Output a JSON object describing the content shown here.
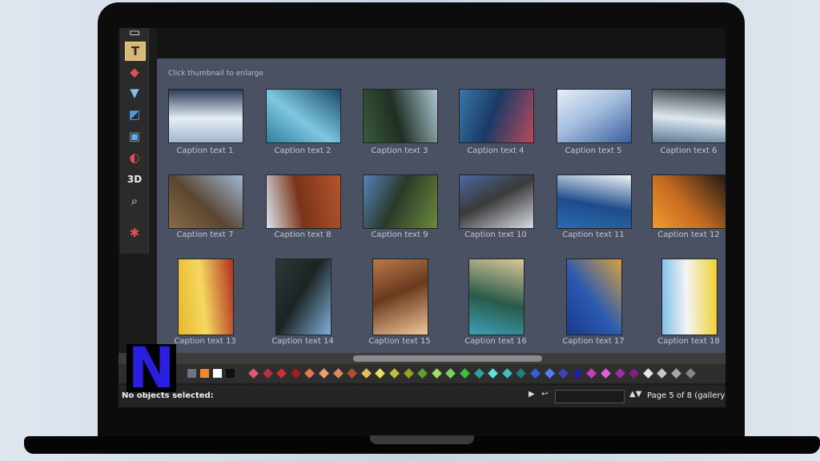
{
  "gallery": {
    "hint": "Click thumbnail to enlarge",
    "items": [
      {
        "caption": "Caption text 1",
        "colors": [
          "#9fb6cf",
          "#2b3d55",
          "#e6eef6"
        ]
      },
      {
        "caption": "Caption text 2",
        "colors": [
          "#2f7fa0",
          "#1a4a66",
          "#7ec7df"
        ]
      },
      {
        "caption": "Caption text 3",
        "colors": [
          "#3a5a3a",
          "#aac4d0",
          "#1f2f24"
        ]
      },
      {
        "caption": "Caption text 4",
        "colors": [
          "#3778a8",
          "#b84a5a",
          "#1a3a66"
        ]
      },
      {
        "caption": "Caption text 5",
        "colors": [
          "#e8eef5",
          "#3b5f9e",
          "#a6bfe0"
        ]
      },
      {
        "caption": "Caption text 6",
        "colors": [
          "#5a7898",
          "#2e3a3e",
          "#dfe8ef"
        ]
      },
      {
        "caption": "Caption text 7",
        "colors": [
          "#8a6a48",
          "#9fb8d6",
          "#5a4632"
        ]
      },
      {
        "caption": "Caption text 8",
        "colors": [
          "#d9e4ee",
          "#b4552e",
          "#7a3418"
        ]
      },
      {
        "caption": "Caption text 9",
        "colors": [
          "#5682b8",
          "#6a8a3a",
          "#2a3a2a"
        ]
      },
      {
        "caption": "Caption text 10",
        "colors": [
          "#4a6aa0",
          "#d8dde4",
          "#3a3a3a"
        ]
      },
      {
        "caption": "Caption text 11",
        "colors": [
          "#2a6ab0",
          "#f0f4f8",
          "#1e4c8a"
        ]
      },
      {
        "caption": "Caption text 12",
        "colors": [
          "#f29a2e",
          "#1d1a18",
          "#c46a20"
        ]
      },
      {
        "caption": "Caption text 13",
        "colors": [
          "#e8b830",
          "#b03020",
          "#f5d860"
        ]
      },
      {
        "caption": "Caption text 14",
        "colors": [
          "#2a3a3a",
          "#7fb0d8",
          "#1c2424"
        ]
      },
      {
        "caption": "Caption text 15",
        "colors": [
          "#b87a4a",
          "#f0c89a",
          "#6a3a1e"
        ]
      },
      {
        "caption": "Caption text 16",
        "colors": [
          "#3aa0b8",
          "#d8c89a",
          "#2a5a4a"
        ]
      },
      {
        "caption": "Caption text 17",
        "colors": [
          "#1a3a8a",
          "#d8a040",
          "#2a5ab0"
        ]
      },
      {
        "caption": "Caption text 18",
        "colors": [
          "#7fc0e8",
          "#f0d030",
          "#f4f4f4"
        ]
      }
    ]
  },
  "palette": {
    "swatches": [
      "#6e7582",
      "#f08a2e",
      "#ffffff",
      "#101010"
    ],
    "diamonds": [
      "#e05a6a",
      "#b83040",
      "#d03030",
      "#a02020",
      "#e07850",
      "#f0a070",
      "#e08860",
      "#b05030",
      "#e0c060",
      "#e8e060",
      "#c0c030",
      "#a0a020",
      "#60a030",
      "#a0e060",
      "#80d060",
      "#40c040",
      "#30a0a0",
      "#60e0e0",
      "#40c0c0",
      "#208080",
      "#3060e0",
      "#5080f0",
      "#4040c0",
      "#2020a0",
      "#c040c0",
      "#e060e0",
      "#a030a0",
      "#802080",
      "#e8e8e8",
      "#c8c8c8",
      "#a8a8a8",
      "#888888"
    ]
  },
  "status": {
    "text": "No objects selected:",
    "page": "Page 5 of 8 (gallery"
  },
  "logo": {
    "letter": "N"
  }
}
